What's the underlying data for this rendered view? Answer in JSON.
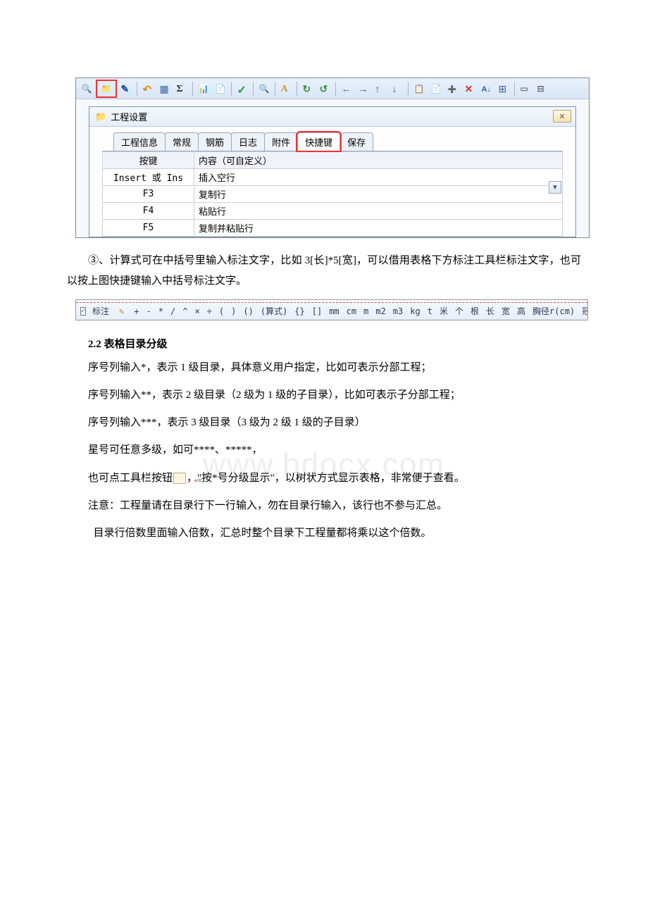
{
  "screenshot1": {
    "dialog_title": "工程设置",
    "tabs": [
      "工程信息",
      "常规",
      "钢筋",
      "日志",
      "附件",
      "快捷键",
      "保存"
    ],
    "active_tab_index": 5,
    "highlight_tab_index": 5,
    "table": {
      "headers": [
        "按键",
        "内容（可自定义）"
      ],
      "rows": [
        {
          "key": "Insert 或 Ins",
          "value": "插入空行"
        },
        {
          "key": "F3",
          "value": "复制行"
        },
        {
          "key": "F4",
          "value": "粘贴行"
        },
        {
          "key": "F5",
          "value": "复制并粘贴行"
        }
      ]
    }
  },
  "para_after_shot1": "③、计算式可在中括号里输入标注文字，比如 3[长]*5[宽]，可以借用表格下方标注工具栏标注文字，也可以按上图快捷键输入中括号标注文字。",
  "toolbar2": {
    "label": "标注",
    "items": [
      "+",
      "-",
      "*",
      "/",
      "^",
      "×",
      "÷",
      "(",
      ")",
      "()",
      "(算式)",
      "{}",
      "[]",
      "mm",
      "cm",
      "m",
      "m2",
      "m3",
      "kg",
      "t",
      "米",
      "个",
      "根",
      "长",
      "宽",
      "高",
      "胸径r(cm)",
      "冠幅(cm)"
    ]
  },
  "section2_2": {
    "heading": "2.2 表格目录分级",
    "p1": "序号列输入*，表示 1 级目录，具体意义用户指定，比如可表示分部工程；",
    "p2": "序号列输入**，表示 2 级目录（2 级为 1 级的子目录），比如可表示子分部工程；",
    "p3": "序号列输入***，表示 3 级目录（3 级为 2 级 1 级的子目录）",
    "p4": "星号可任意多级，如可****、*****，",
    "p5_a": "也可点工具栏按钮",
    "p5_b": "，\"按*号分级显示\"，以树状方式显示表格，非常便于查看。",
    "p6": "注意：工程量请在目录行下一行输入，勿在目录行输入，该行也不参与汇总。",
    "p7": "目录行倍数里面输入倍数，汇总时整个目录下工程量都将乘以这个倍数。"
  },
  "watermark": "www.bdocx.com"
}
